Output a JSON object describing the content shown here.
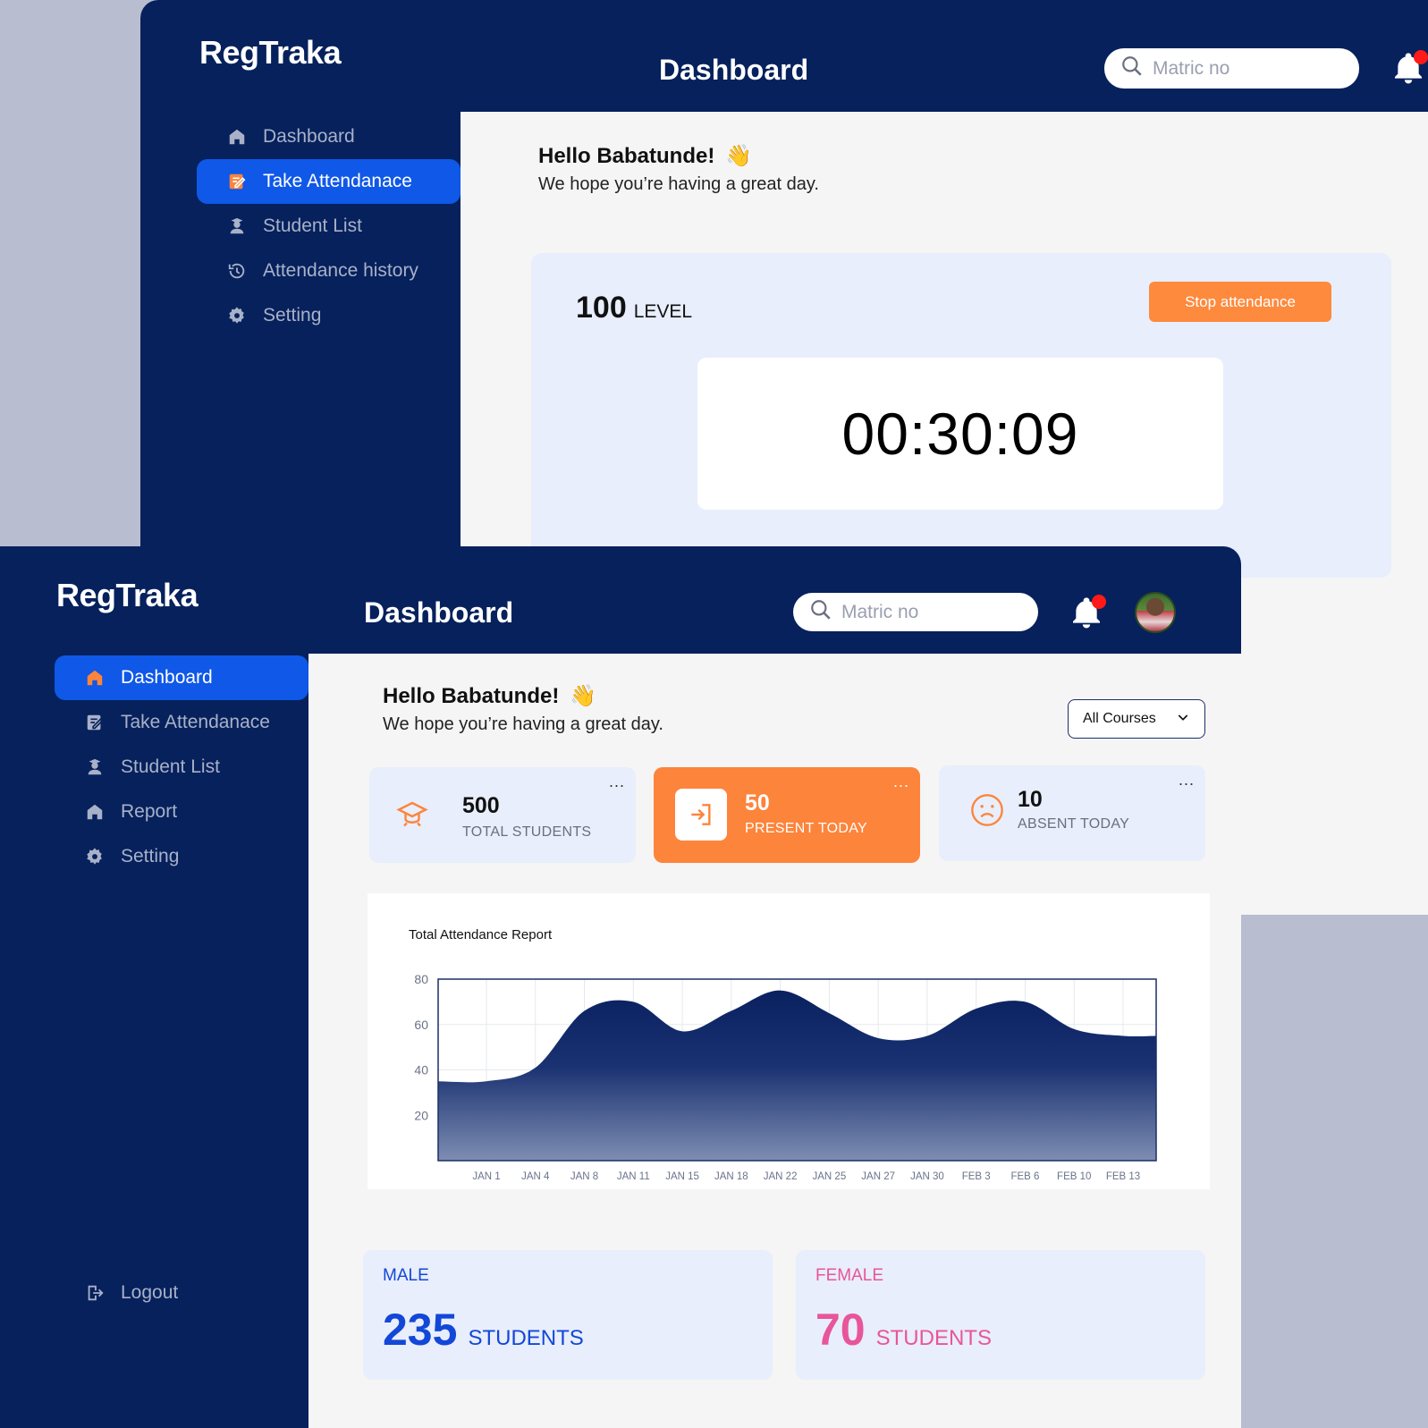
{
  "attendance_window": {
    "brand": "RegTraka",
    "page_title": "Dashboard",
    "search": {
      "placeholder": "Matric no"
    },
    "nav": [
      "Dashboard",
      "Take Attendanace",
      "Student List",
      "Attendance history",
      "Setting"
    ],
    "active_nav": "Take Attendanace",
    "greeting": {
      "hello": "Hello Babatunde!",
      "emoji": "👋",
      "sub": "We hope you’re having a great day."
    },
    "level": {
      "number": "100",
      "label": "LEVEL"
    },
    "stop_button": "Stop attendance",
    "timer": "00:30:09"
  },
  "dashboard_window": {
    "brand": "RegTraka",
    "page_title": "Dashboard",
    "search": {
      "placeholder": "Matric no"
    },
    "nav": [
      "Dashboard",
      "Take Attendanace",
      "Student List",
      "Report",
      "Setting"
    ],
    "active_nav": "Dashboard",
    "logout": "Logout",
    "greeting": {
      "hello": "Hello Babatunde!",
      "emoji": "👋",
      "sub": "We hope you’re having a great day."
    },
    "course_filter": "All Courses",
    "stats": [
      {
        "value": "500",
        "label": "TOTAL STUDENTS",
        "icon": "graduation-cap-icon",
        "more": "..."
      },
      {
        "value": "50",
        "label": "PRESENT TODAY",
        "icon": "sign-in-icon",
        "more": "..."
      },
      {
        "value": "10",
        "label": "ABSENT TODAY",
        "icon": "sad-face-icon",
        "more": "..."
      }
    ],
    "gender": {
      "male": {
        "label": "MALE",
        "value": "235",
        "unit": "STUDENTS"
      },
      "female": {
        "label": "FEMALE",
        "value": "70",
        "unit": "STUDENTS"
      }
    }
  },
  "colors": {
    "navy": "#06215c",
    "active_blue": "#0f58e8",
    "orange": "#fd843b",
    "male_blue": "#1347d8",
    "female_pink": "#e8559a",
    "card_bg": "#e8eefb"
  },
  "chart_data": {
    "type": "area",
    "title": "Total Attendance Report",
    "x": [
      "JAN 1",
      "JAN 4",
      "JAN 8",
      "JAN 11",
      "JAN 15",
      "JAN 18",
      "JAN 22",
      "JAN 25",
      "JAN 27",
      "JAN 30",
      "FEB 3",
      "FEB 6",
      "FEB 10",
      "FEB 13"
    ],
    "series": [
      {
        "values": [
          35,
          41,
          66,
          70,
          57,
          66,
          75,
          65,
          54,
          55,
          67,
          70,
          58,
          55
        ]
      }
    ],
    "y_ticks": [
      20,
      40,
      60,
      80
    ],
    "ylim": [
      0,
      80
    ],
    "grid": true
  }
}
